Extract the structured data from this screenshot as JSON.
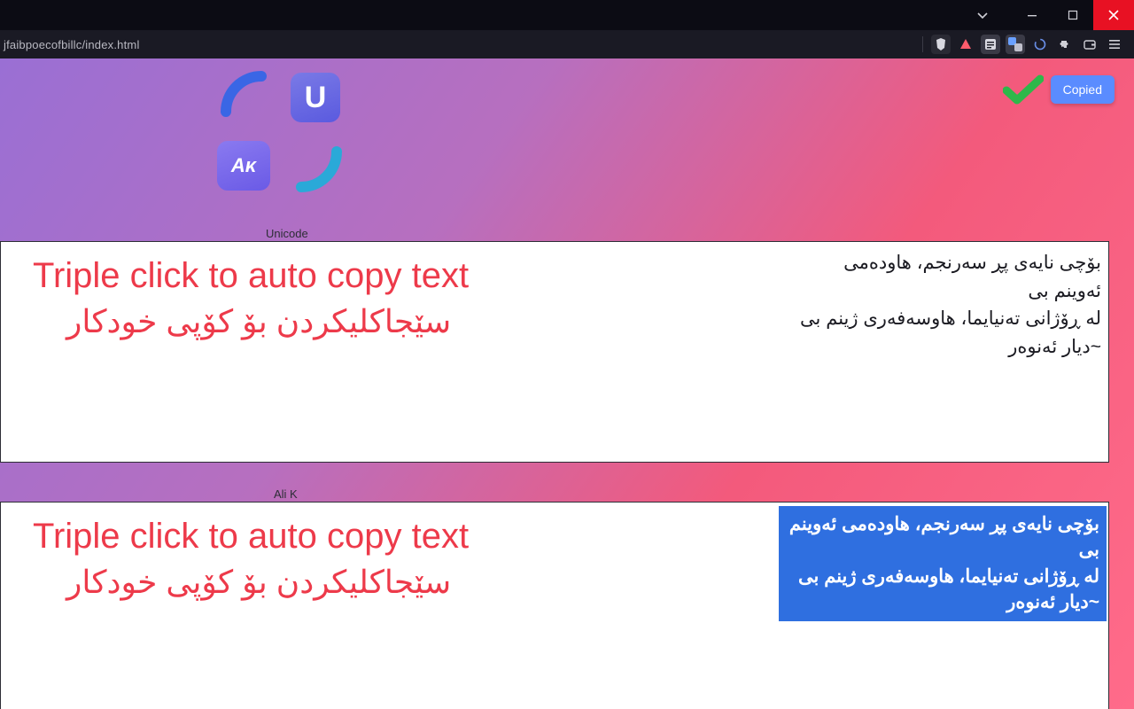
{
  "window": {
    "url_tail": "jfaibpoecofbillc/index.html"
  },
  "toast": {
    "copied_label": "Copied"
  },
  "logo": {
    "u_label": "U",
    "ak_label": "Aᴋ"
  },
  "sections": {
    "unicode": {
      "label": "Unicode",
      "hint_en": "Triple click to auto copy text",
      "hint_ku": "سێجاکلیکردن بۆ کۆپی خودکار",
      "content": "بۆچی نایەی پڕ سەرنجم، هاودەمی ئەوینم بی\nلە ڕۆژانی تەنیایما، هاوسەفەری ژینم بی\n~دیار ئەنوەر"
    },
    "alik": {
      "label": "Ali K",
      "hint_en": "Triple click to auto copy text",
      "hint_ku": "سێجاکلیکردن بۆ کۆپی خودکار",
      "content": "بۆچی نایەی پڕ سەرنجم، هاودەمی ئەوینم بی\nلە ڕۆژانی تەنیایما، هاوسەفەری ژینم بی\n~دیار ئەنوەر"
    }
  }
}
